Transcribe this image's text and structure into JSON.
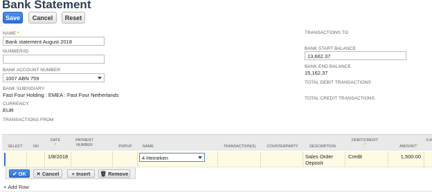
{
  "page": {
    "title": "Bank Statement"
  },
  "toolbar": {
    "save_label": "Save",
    "cancel_label": "Cancel",
    "reset_label": "Reset"
  },
  "left_fields": {
    "name_label": "NAME",
    "name_value": "Bank statement August 2018",
    "number_label": "NUMBER/ID",
    "number_value": "",
    "bank_account_label": "BANK ACCOUNT NUMBER",
    "bank_account_value": "1007 ABN 759",
    "subsidiary_label": "BANK SUBSIDIARY",
    "subsidiary_value": "Fast Four Holding : EMEA : Fast Four Netherlands",
    "currency_label": "CURRENCY",
    "currency_value": "EUR",
    "transactions_from_label": "TRANSACTIONS FROM"
  },
  "right_fields": {
    "transactions_to_label": "TRANSACTIONS TO",
    "start_balance_label": "BANK START BALANCE",
    "start_balance_value": "13,662.37",
    "end_balance_label": "BANK END BALANCE",
    "end_balance_value": "15,162.37",
    "total_debit_label": "TOTAL DEBIT TRANSACTIONS",
    "total_credit_label": "TOTAL CREDIT TRANSACTIONS"
  },
  "grid": {
    "columns": {
      "select": "SELECT",
      "no": "NO",
      "date": "DATE",
      "payment_number": "PAYMENT NUMBER",
      "popup": "POPUP",
      "name": "NAME",
      "transactions": "TRANSACTION(S)",
      "counterparty": "COUNTERPARTY",
      "description": "DESCRIPTION",
      "debit_credit": "DEBIT/CREDIT",
      "amount": "AMOUNT",
      "extra": "S A"
    },
    "row": {
      "date": "1/8/2018",
      "name": "4 Heineken",
      "description_line1": "Sales Order",
      "description_line2": "Deposit",
      "debit_credit": "Credit",
      "amount": "1,500.00"
    }
  },
  "edit_actions": {
    "ok": "OK",
    "cancel": "Cancel",
    "insert": "Insert",
    "remove": "Remove"
  },
  "add_row_label": "Add Row",
  "colors": {
    "accent": "#2c6fd6",
    "title": "#2c3e57",
    "required": "#e99a1d",
    "row_highlight": "#fdfbe4"
  }
}
